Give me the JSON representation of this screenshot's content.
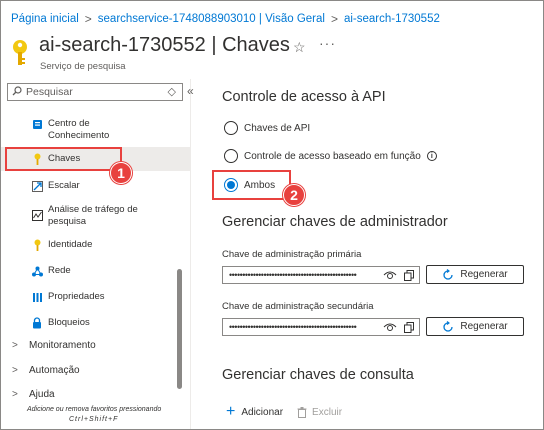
{
  "breadcrumb": {
    "items": [
      "Página inicial",
      "searchservice-1748088903010 | Visão Geral",
      "ai-search-1730552"
    ]
  },
  "header": {
    "title": "ai-search-1730552 | Chaves",
    "subtitle": "Serviço de pesquisa",
    "star": "☆",
    "more": "···"
  },
  "sidebar": {
    "search_placeholder": "Pesquisar",
    "clear_glyph": "◇",
    "collapse_glyph": "«",
    "items": [
      {
        "label": "Centro de Conhecimento",
        "icon": "knowledge-center-icon"
      },
      {
        "label": "Chaves",
        "icon": "key-icon",
        "selected": true
      },
      {
        "label": "Escalar",
        "icon": "scale-icon"
      },
      {
        "label": "Análise de tráfego de pesquisa",
        "icon": "traffic-analysis-icon"
      },
      {
        "label": "Identidade",
        "icon": "identity-icon"
      },
      {
        "label": "Rede",
        "icon": "network-icon"
      },
      {
        "label": "Propriedades",
        "icon": "properties-icon"
      },
      {
        "label": "Bloqueios",
        "icon": "lock-icon"
      }
    ],
    "groups": [
      {
        "label": "Monitoramento"
      },
      {
        "label": "Automação"
      },
      {
        "label": "Ajuda"
      }
    ],
    "tooltip_line1": "Adicione ou remova favoritos pressionando",
    "tooltip_line2": "Ctrl+Shift+F"
  },
  "callouts": {
    "step1": "1",
    "step2": "2",
    "color": "#e8413e"
  },
  "main": {
    "api_access": {
      "title": "Controle de acesso à API",
      "options": [
        {
          "label": "Chaves de API",
          "checked": false
        },
        {
          "label": "Controle de acesso baseado em função",
          "checked": false,
          "info": true
        },
        {
          "label": "Ambos",
          "checked": true
        }
      ]
    },
    "admin_keys": {
      "title": "Gerenciar chaves de administrador",
      "primary_label": "Chave de administração primária",
      "primary_value": "••••••••••••••••••••••••••••••••••••••••••••••••",
      "secondary_label": "Chave de administração secundária",
      "secondary_value": "••••••••••••••••••••••••••••••••••••••••••••••••",
      "regenerate_label": "Regenerar"
    },
    "query_keys": {
      "title": "Gerenciar chaves de consulta",
      "add_label": "Adicionar",
      "delete_label": "Excluir"
    }
  },
  "colors": {
    "accent": "#0078d4",
    "key_icon": "#f2c811",
    "callout": "#e8413e"
  }
}
